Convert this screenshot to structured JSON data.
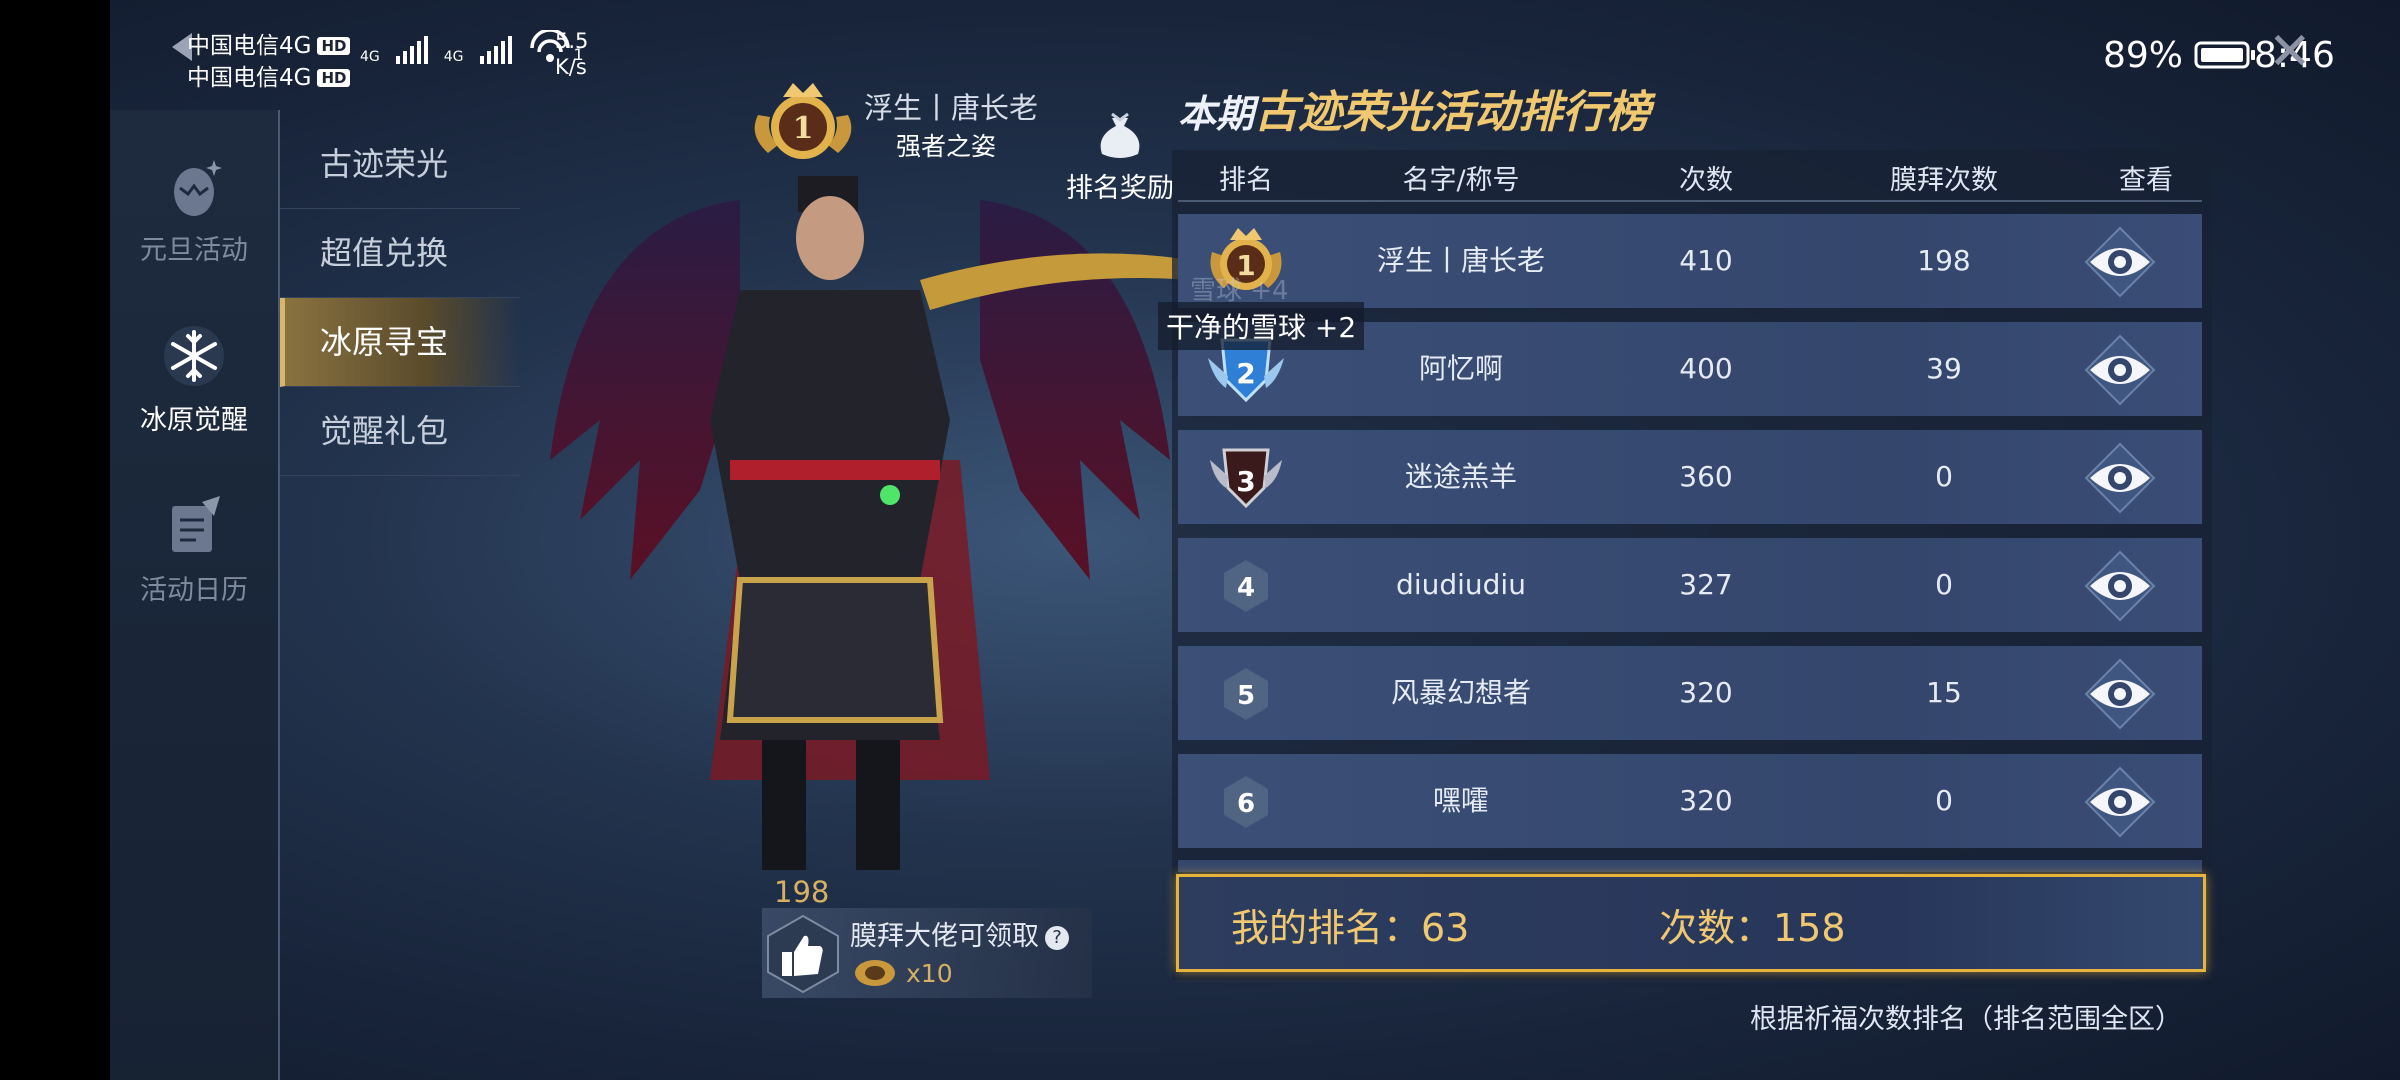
{
  "status_bar": {
    "carrier1": "中国电信4G",
    "carrier2": "中国电信4G",
    "hd": "HD",
    "net1": "4G",
    "net2": "4G",
    "wifi_level": "1",
    "speed_value": "5.5",
    "speed_unit": "K/s",
    "battery": "89%",
    "time": "8:46"
  },
  "sidebar": {
    "items": [
      {
        "label": "元旦活动",
        "icon": "egg-icon"
      },
      {
        "label": "冰原觉醒",
        "icon": "snowflake-icon"
      },
      {
        "label": "活动日历",
        "icon": "calendar-book-icon"
      }
    ],
    "active": 1
  },
  "submenu": {
    "items": [
      "古迹荣光",
      "超值兑换",
      "冰原寻宝",
      "觉醒礼包"
    ],
    "active": 2
  },
  "character": {
    "rank_badge": "1",
    "name": "浮生丨唐长老",
    "title": "强者之姿",
    "likes": "198",
    "like_text": "膜拜大佬可领取",
    "like_help": "?",
    "like_reward": "x10"
  },
  "reward_button": {
    "label": "排名奖励"
  },
  "leaderboard": {
    "title_prefix": "本期",
    "title_main": "古迹荣光活动排行榜",
    "headers": [
      "排名",
      "名字/称号",
      "次数",
      "膜拜次数",
      "查看"
    ],
    "rows": [
      {
        "rank": "1",
        "name": "浮生丨唐长老",
        "count": "410",
        "worship": "198"
      },
      {
        "rank": "2",
        "name": "阿忆啊",
        "count": "400",
        "worship": "39"
      },
      {
        "rank": "3",
        "name": "迷途羔羊",
        "count": "360",
        "worship": "0"
      },
      {
        "rank": "4",
        "name": "diudiudiu",
        "count": "327",
        "worship": "0"
      },
      {
        "rank": "5",
        "name": "风暴幻想者",
        "count": "320",
        "worship": "15"
      },
      {
        "rank": "6",
        "name": "嘿嚯",
        "count": "320",
        "worship": "0"
      }
    ],
    "my_rank_label": "我的排名：63",
    "my_count_label": "次数：158",
    "footnote": "根据祈福次数排名（排名范围全区）"
  },
  "toast": {
    "text": "干净的雪球 +2",
    "ghost_text": "雪球 +4"
  },
  "colors": {
    "gold": "#f0c870",
    "row_bg": "#3b4f77",
    "highlight_border": "#e6b33c"
  }
}
